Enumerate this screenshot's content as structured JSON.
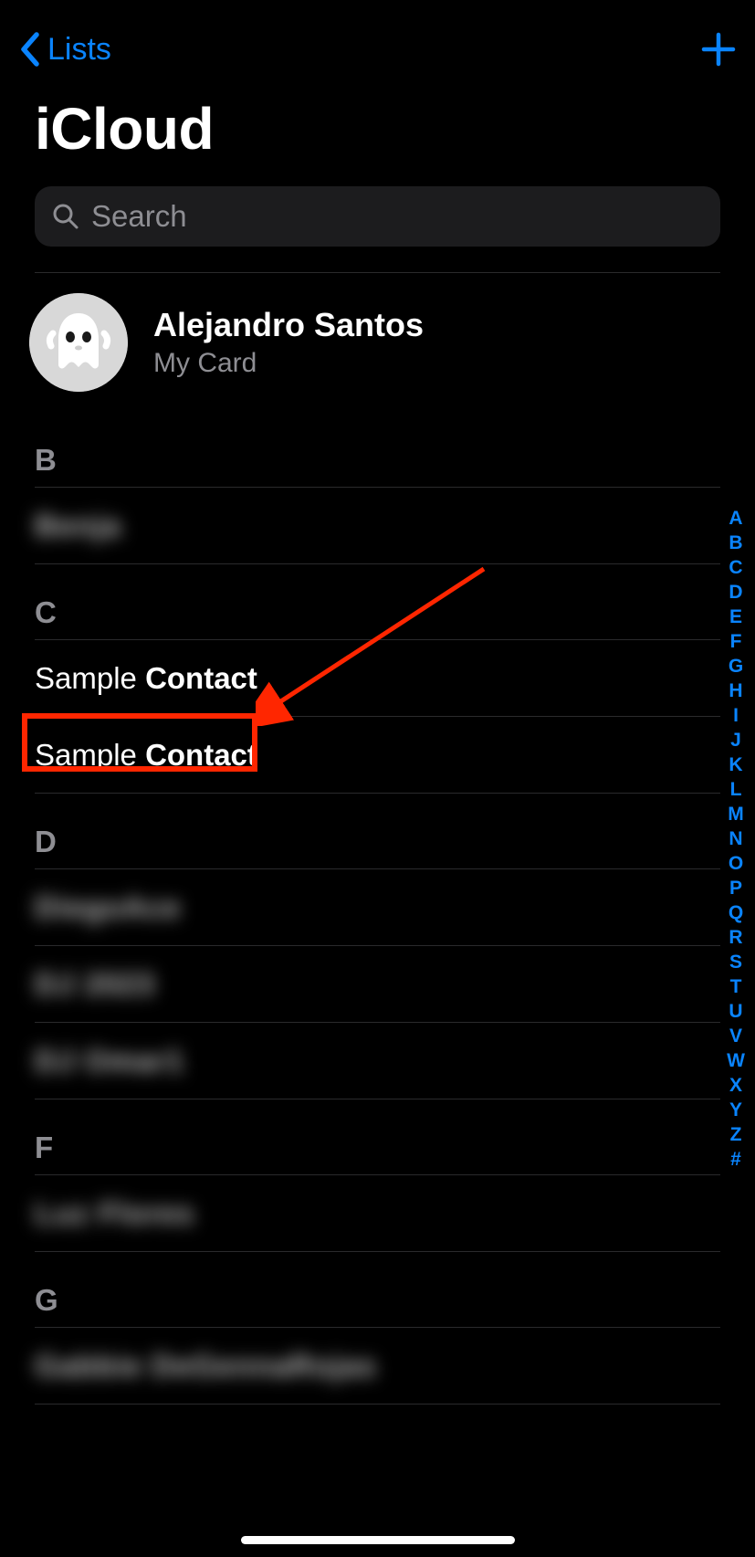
{
  "nav": {
    "back_label": "Lists"
  },
  "title": "iCloud",
  "search": {
    "placeholder": "Search"
  },
  "my_card": {
    "name": "Alejandro Santos",
    "subtitle": "My Card"
  },
  "sections": [
    {
      "letter": "B",
      "contacts": [
        {
          "first": "Benja",
          "last": "",
          "blurred": true
        }
      ]
    },
    {
      "letter": "C",
      "contacts": [
        {
          "first": "Sample ",
          "last": "Contact",
          "blurred": false
        },
        {
          "first": "Sample ",
          "last": "Contact",
          "blurred": false,
          "highlighted": true
        }
      ]
    },
    {
      "letter": "D",
      "contacts": [
        {
          "first": "DiegoAce",
          "last": "",
          "blurred": true
        },
        {
          "first": "DJ 2023",
          "last": "",
          "blurred": true
        },
        {
          "first": "DJ Omar1",
          "last": "",
          "blurred": true
        }
      ]
    },
    {
      "letter": "F",
      "contacts": [
        {
          "first": "Luz Flores",
          "last": "",
          "blurred": true
        }
      ]
    },
    {
      "letter": "G",
      "contacts": [
        {
          "first": "Gabbie DeGennaRojas",
          "last": "",
          "blurred": true
        }
      ]
    }
  ],
  "index": [
    "A",
    "B",
    "C",
    "D",
    "E",
    "F",
    "G",
    "H",
    "I",
    "J",
    "K",
    "L",
    "M",
    "N",
    "O",
    "P",
    "Q",
    "R",
    "S",
    "T",
    "U",
    "V",
    "W",
    "X",
    "Y",
    "Z",
    "#"
  ],
  "annotation": {
    "color": "#ff2600"
  }
}
